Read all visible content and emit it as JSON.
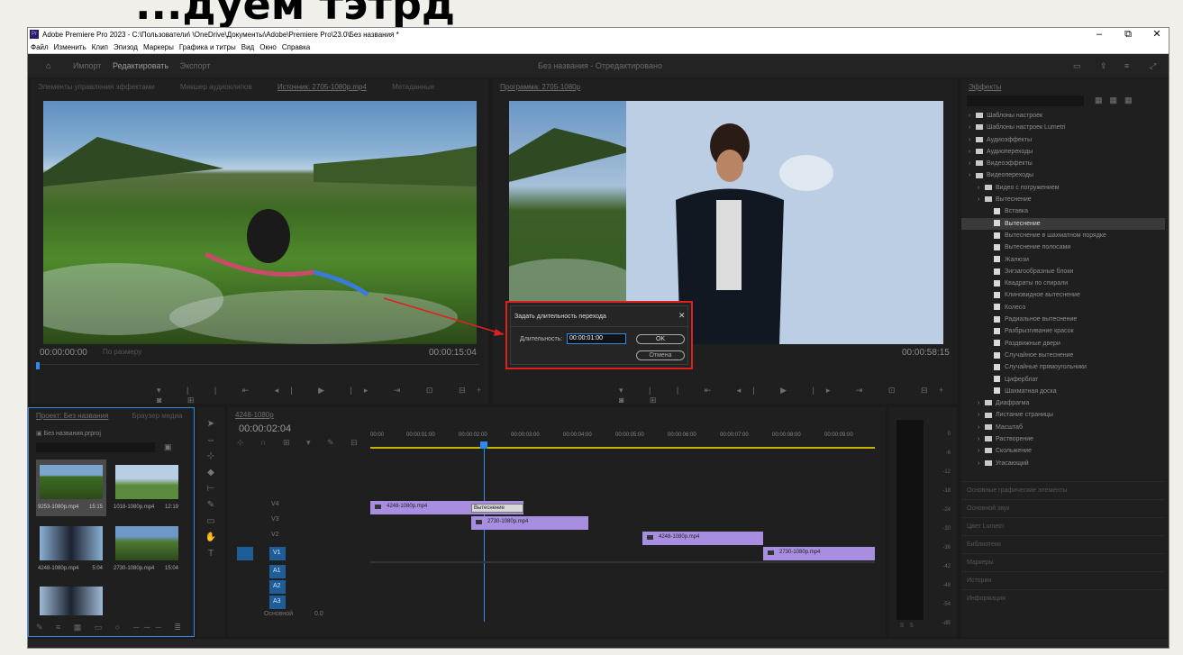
{
  "heading": "...дуем тэтрд",
  "window": {
    "title": "Adobe Premiere Pro 2023 - C:\\Пользователи\\ \\OneDrive\\Документы\\Adobe\\Premiere Pro\\23.0\\Без названия *",
    "min": "–",
    "max": "⧉",
    "close": "✕"
  },
  "menu": [
    "Файл",
    "Изменить",
    "Клип",
    "Эпизод",
    "Маркеры",
    "Графика и титры",
    "Вид",
    "Окно",
    "Справка"
  ],
  "workspace": {
    "tabs": [
      "Импорт",
      "Редактировать",
      "Экспорт"
    ],
    "project_title": "Без названия - Отредактировано"
  },
  "source": {
    "tabs": [
      "Элементы управления эффектами",
      "Микшер аудиоклипов",
      "Источник: 2705-1080p.mp4",
      "Метаданные"
    ],
    "timecode_in": "00:00:00:00",
    "timecode_out": "00:00:15:04",
    "fit": "По размеру"
  },
  "program": {
    "tab": "Программа: 2705-1080p",
    "timecode_out": "00:00:58:15"
  },
  "dialog": {
    "title": "Задать длительность перехода",
    "label": "Длительность:",
    "value": "00:00:01:00",
    "ok": "OK",
    "cancel": "Отмена",
    "close": "✕"
  },
  "project": {
    "tabs": [
      "Проект: Без названия",
      "Браузер медиа"
    ],
    "file": "Без названия.prproj",
    "items": [
      {
        "name": "9253-1080p.mp4",
        "dur": "15:15"
      },
      {
        "name": "1018-1080p.mp4",
        "dur": "12:19"
      },
      {
        "name": "4248-1080p.mp4",
        "dur": "5:04"
      },
      {
        "name": "2730-1080p.mp4",
        "dur": "15:04"
      },
      {
        "name": "",
        "dur": ""
      }
    ]
  },
  "timeline": {
    "tab": "4248-1080p",
    "timecode": "00:00:02:04",
    "ruler": [
      "00:00",
      "00:00:01:00",
      "00:00:02:00",
      "00:00:03:00",
      "00:00:04:00",
      "00:00:05:00",
      "00:00:06:00",
      "00:00:07:00",
      "00:00:08:00",
      "00:00:09:00"
    ],
    "video_tracks": [
      "V4",
      "V3",
      "V2",
      "V1"
    ],
    "audio_tracks": [
      "A1",
      "A2",
      "A3"
    ],
    "mix": "Основной",
    "mix_val": "0.0",
    "clips": [
      {
        "label": "4248-1080p.mp4"
      },
      {
        "label": "2730-1080p.mp4"
      },
      {
        "label": "4248-1080p.mp4"
      },
      {
        "label": "2730-1080p.mp4"
      }
    ],
    "transition": "Вытеснение"
  },
  "meter": {
    "ticks": [
      "0",
      "-6",
      "-12",
      "-18",
      "-24",
      "-30",
      "-36",
      "-42",
      "-48",
      "-54",
      "-dB"
    ],
    "bottom": [
      "S",
      "S"
    ]
  },
  "effects": {
    "title": "Эффекты",
    "tree": [
      {
        "t": "folder",
        "l": "Шаблоны настроек",
        "d": 0
      },
      {
        "t": "folder",
        "l": "Шаблоны настроек Lumetri",
        "d": 0
      },
      {
        "t": "folder",
        "l": "Аудиоэффекты",
        "d": 0
      },
      {
        "t": "folder",
        "l": "Аудиопереходы",
        "d": 0
      },
      {
        "t": "folder",
        "l": "Видеоэффекты",
        "d": 0
      },
      {
        "t": "folder",
        "l": "Видеопереходы",
        "d": 0
      },
      {
        "t": "folder",
        "l": "Видео с погружением",
        "d": 1
      },
      {
        "t": "folder",
        "l": "Вытеснение",
        "d": 1
      },
      {
        "t": "fx",
        "l": "Вставка",
        "d": 2
      },
      {
        "t": "fx",
        "l": "Вытеснение",
        "d": 2,
        "sel": true
      },
      {
        "t": "fx",
        "l": "Вытеснение в шахматном порядке",
        "d": 2
      },
      {
        "t": "fx",
        "l": "Вытеснение полосами",
        "d": 2
      },
      {
        "t": "fx",
        "l": "Жалюзи",
        "d": 2
      },
      {
        "t": "fx",
        "l": "Зигзагообразные блоки",
        "d": 2
      },
      {
        "t": "fx",
        "l": "Квадраты по спирали",
        "d": 2
      },
      {
        "t": "fx",
        "l": "Клиновидное вытеснение",
        "d": 2
      },
      {
        "t": "fx",
        "l": "Колесо",
        "d": 2
      },
      {
        "t": "fx",
        "l": "Радиальное вытеснение",
        "d": 2
      },
      {
        "t": "fx",
        "l": "Разбрызгивание красок",
        "d": 2
      },
      {
        "t": "fx",
        "l": "Раздвижные двери",
        "d": 2
      },
      {
        "t": "fx",
        "l": "Случайное вытеснение",
        "d": 2
      },
      {
        "t": "fx",
        "l": "Случайные прямоугольники",
        "d": 2
      },
      {
        "t": "fx",
        "l": "Циферблат",
        "d": 2
      },
      {
        "t": "fx",
        "l": "Шахматная доска",
        "d": 2
      },
      {
        "t": "folder",
        "l": "Диафрагма",
        "d": 1
      },
      {
        "t": "folder",
        "l": "Листание страницы",
        "d": 1
      },
      {
        "t": "folder",
        "l": "Масштаб",
        "d": 1
      },
      {
        "t": "folder",
        "l": "Растворение",
        "d": 1
      },
      {
        "t": "folder",
        "l": "Скольжение",
        "d": 1
      },
      {
        "t": "folder",
        "l": "Угасающий",
        "d": 1
      }
    ],
    "sections": [
      "Основные графические элементы",
      "Основной звук",
      "Цвет Lumetri",
      "Библиотеки",
      "Маркеры",
      "История",
      "Информация"
    ]
  },
  "colors": {
    "accent": "#2d8ceb",
    "clip": "#a88ee0",
    "highlight": "#e02020"
  }
}
